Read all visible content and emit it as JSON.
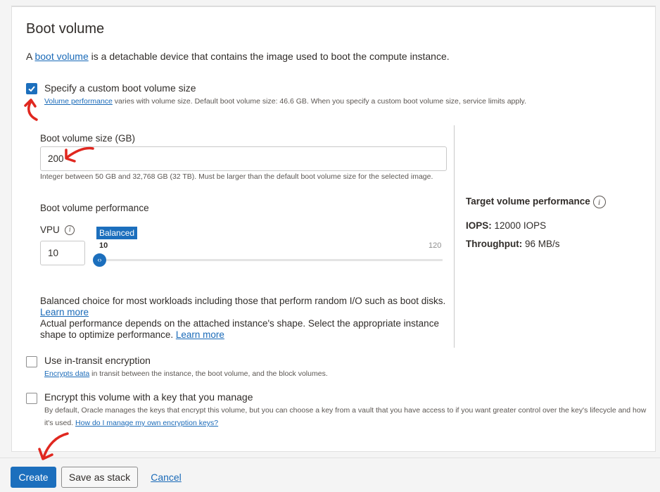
{
  "section": {
    "title": "Boot volume",
    "desc_prefix": "A ",
    "desc_link": "boot volume",
    "desc_suffix": " is a detachable device that contains the image used to boot the compute instance."
  },
  "custom_size": {
    "checked": true,
    "label": "Specify a custom boot volume size",
    "help_link": "Volume performance",
    "help_text": " varies with volume size. Default boot volume size: 46.6 GB. When you specify a custom boot volume size, service limits apply."
  },
  "size_field": {
    "label": "Boot volume size (GB)",
    "value": "200",
    "help": "Integer between 50 GB and 32,768 GB (32 TB). Must be larger than the default boot volume size for the selected image."
  },
  "performance": {
    "heading": "Boot volume performance",
    "vpu_label": "VPU",
    "vpu_value": "10",
    "slider_tooltip": "Balanced",
    "slider_min": "10",
    "slider_max": "120",
    "slider_value": 10,
    "desc1": "Balanced choice for most workloads including those that perform random I/O such as boot disks.",
    "desc1_link": "Learn more",
    "desc2": "Actual performance depends on the attached instance's shape. Select the appropriate instance shape to optimize performance.",
    "desc2_link": "Learn more"
  },
  "target": {
    "heading": "Target volume performance",
    "iops_label": "IOPS:",
    "iops_value": "12000 IOPS",
    "throughput_label": "Throughput:",
    "throughput_value": "96 MB/s"
  },
  "transit": {
    "checked": false,
    "label": "Use in-transit encryption",
    "help_link": "Encrypts data",
    "help_text": " in transit between the instance, the boot volume, and the block volumes."
  },
  "own_key": {
    "checked": false,
    "label": "Encrypt this volume with a key that you manage",
    "help_text": "By default, Oracle manages the keys that encrypt this volume, but you can choose a key from a vault that you have access to if you want greater control over the key's lifecycle and how it's used.",
    "help_link": "How do I manage my own encryption keys?"
  },
  "footer": {
    "create": "Create",
    "save_stack": "Save as stack",
    "cancel": "Cancel"
  },
  "colors": {
    "accent": "#1c6fbd",
    "annotation": "#e0271f"
  }
}
